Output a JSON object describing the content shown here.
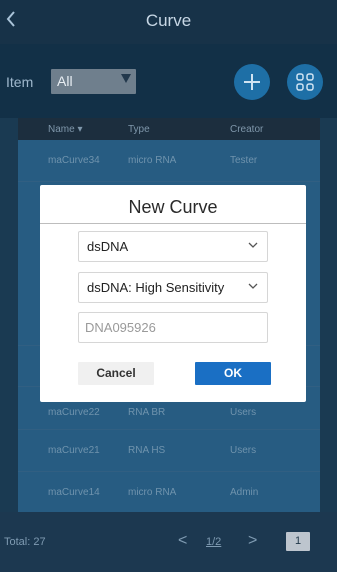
{
  "header": {
    "title": "Curve",
    "back_icon": "chevron-left-icon"
  },
  "filter": {
    "item_label": "Item",
    "item_value": "All",
    "add_icon": "plus-icon",
    "grid_icon": "grid-icon"
  },
  "table": {
    "columns": [
      "Name ▾",
      "Type",
      "Creator"
    ],
    "rows": [
      {
        "name": "maCurve34",
        "type": "micro RNA",
        "creator": "Tester"
      },
      {
        "name": "maCurve22",
        "type": "RNA BR",
        "creator": "Users"
      },
      {
        "name": "maCurve21",
        "type": "RNA HS",
        "creator": "Users"
      },
      {
        "name": "maCurve14",
        "type": "micro RNA",
        "creator": "Admin"
      }
    ]
  },
  "footer": {
    "total": "Total: 27",
    "prev": "<",
    "page": "1/2",
    "next": ">",
    "page_box": "1"
  },
  "dialog": {
    "title": "New Curve",
    "select_1": "dsDNA",
    "select_2": "dsDNA: High Sensitivity",
    "input_placeholder": "DNA095926",
    "cancel_label": "Cancel",
    "ok_label": "OK"
  }
}
